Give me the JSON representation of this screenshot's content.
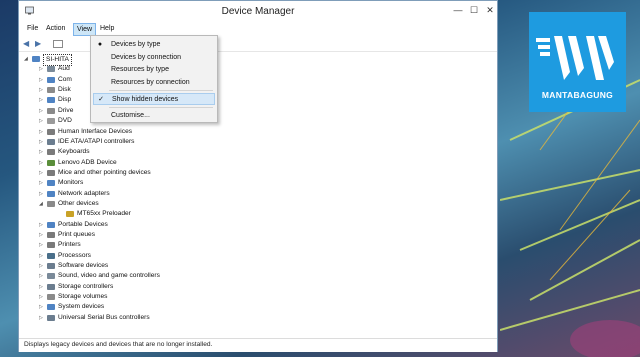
{
  "window": {
    "title": "Device Manager",
    "minimize_glyph": "—",
    "maximize_glyph": "☐",
    "close_glyph": "✕"
  },
  "menubar": {
    "file": "File",
    "action": "Action",
    "view": "View",
    "help": "Help"
  },
  "toolbar": {
    "back_glyph": "◀",
    "forward_glyph": "▶"
  },
  "view_menu": {
    "items": [
      {
        "label": "Devices by type",
        "mark": "●"
      },
      {
        "label": "Devices by connection",
        "mark": ""
      },
      {
        "label": "Resources by type",
        "mark": ""
      },
      {
        "label": "Resources by connection",
        "mark": ""
      },
      {
        "label": "Show hidden devices",
        "mark": "✓"
      },
      {
        "label": "Customise...",
        "mark": ""
      }
    ]
  },
  "tree": {
    "root": "SI-HITA",
    "expand_collapsed": "▷",
    "expand_open": "◢",
    "items": [
      {
        "label": "Aud",
        "icon": "speaker-icon",
        "color": "#7a8a99"
      },
      {
        "label": "Com",
        "icon": "computer-icon",
        "color": "#4f83c3"
      },
      {
        "label": "Disk",
        "icon": "disk-icon",
        "color": "#8a8a8a"
      },
      {
        "label": "Disp",
        "icon": "display-icon",
        "color": "#4f83c3"
      },
      {
        "label": "Drive",
        "icon": "drive-icon",
        "color": "#8a8a8a"
      },
      {
        "label": "DVD",
        "icon": "dvd-icon",
        "color": "#9a9a9a"
      },
      {
        "label": "Human Interface Devices",
        "icon": "hid-icon",
        "color": "#7b7b7b"
      },
      {
        "label": "IDE ATA/ATAPI controllers",
        "icon": "ide-icon",
        "color": "#6b7d8f"
      },
      {
        "label": "Keyboards",
        "icon": "keyboard-icon",
        "color": "#7a7a7a"
      },
      {
        "label": "Lenovo ADB Device",
        "icon": "adb-icon",
        "color": "#5a8e3a"
      },
      {
        "label": "Mice and other pointing devices",
        "icon": "mouse-icon",
        "color": "#7a7a7a"
      },
      {
        "label": "Monitors",
        "icon": "monitor-icon",
        "color": "#4f83c3"
      },
      {
        "label": "Network adapters",
        "icon": "network-icon",
        "color": "#4f83c3"
      },
      {
        "label": "Other devices",
        "icon": "unknown-device-icon",
        "color": "#8a8a8a"
      },
      {
        "label": "MT65xx Preloader",
        "icon": "warning-device-icon",
        "color": "#c9a227"
      },
      {
        "label": "Portable Devices",
        "icon": "portable-icon",
        "color": "#4f83c3"
      },
      {
        "label": "Print queues",
        "icon": "printer-icon",
        "color": "#7a7a7a"
      },
      {
        "label": "Printers",
        "icon": "printer-icon",
        "color": "#7a7a7a"
      },
      {
        "label": "Processors",
        "icon": "processor-icon",
        "color": "#4a6f8a"
      },
      {
        "label": "Software devices",
        "icon": "software-icon",
        "color": "#6b7d8f"
      },
      {
        "label": "Sound, video and game controllers",
        "icon": "sound-icon",
        "color": "#7a8a99"
      },
      {
        "label": "Storage controllers",
        "icon": "storage-icon",
        "color": "#6b7d8f"
      },
      {
        "label": "Storage volumes",
        "icon": "volume-icon",
        "color": "#8a8a8a"
      },
      {
        "label": "System devices",
        "icon": "system-icon",
        "color": "#4f83c3"
      },
      {
        "label": "Universal Serial Bus controllers",
        "icon": "usb-icon",
        "color": "#6b7d8f"
      }
    ]
  },
  "statusbar": {
    "text": "Displays legacy devices and devices that are no longer installed."
  },
  "logo": {
    "text": "MANTABAGUNG"
  }
}
